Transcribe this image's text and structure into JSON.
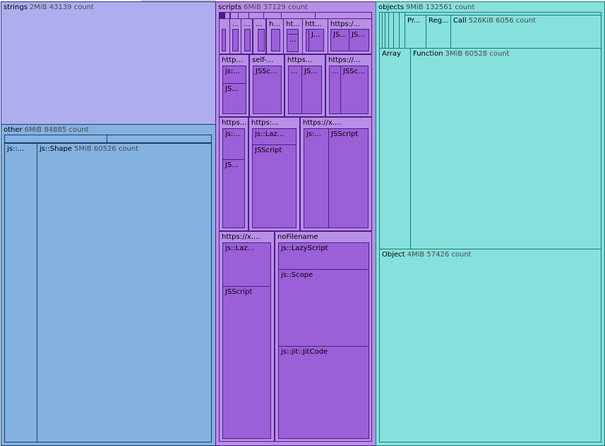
{
  "chart_data": {
    "type": "treemap",
    "colors": {
      "strings": {
        "fill": "#aeaeee",
        "border": "#2a2a8c"
      },
      "other": {
        "fill": "#84b2e0",
        "border": "#1b3d6e"
      },
      "scripts": {
        "fill": "#b98ee6",
        "border": "#4a1e8a"
      },
      "scripts_leaf": {
        "fill": "#9b5fd8",
        "border": "#4a1e8a"
      },
      "objects": {
        "fill": "#86e0de",
        "border": "#1a7a76"
      }
    },
    "groups": [
      {
        "name": "strings",
        "size": "2MiB",
        "count": "43139 count"
      },
      {
        "name": "other",
        "size": "6MiB",
        "count": "84885 count",
        "children": [
          {
            "name": "js::...",
            "size": "",
            "count": ""
          },
          {
            "name": "js::Shape",
            "size": "5MiB",
            "count": "60526 count"
          }
        ]
      },
      {
        "name": "scripts",
        "size": "6MiB",
        "count": "37129 count",
        "children": [
          {
            "name": "http..."
          },
          {
            "name": "self-..."
          },
          {
            "name": "https..."
          },
          {
            "name": "https://..."
          },
          {
            "name": "https..."
          },
          {
            "name": "https:..."
          },
          {
            "name": "https://x...."
          },
          {
            "name": "https://x...."
          },
          {
            "name": "noFilename",
            "children": [
              {
                "name": "js::LazyScript"
              },
              {
                "name": "js::Scope"
              },
              {
                "name": "js::jit::JitCode"
              }
            ]
          }
        ],
        "leaf_labels": [
          "...",
          "...",
          "...",
          "h...",
          "ht...",
          "htt...",
          "https:/...",
          "...",
          "J...",
          "JS...",
          "js:...",
          "JS...",
          "JSSc...",
          "...",
          "JS...",
          "JSSc...",
          "JS...",
          "js::Laz...",
          "JSScript",
          "JSScript",
          "js::Laz...",
          "JSScript"
        ]
      },
      {
        "name": "objects",
        "size": "9MiB",
        "count": "132561 count",
        "children": [
          {
            "name": "Pr..."
          },
          {
            "name": "Reg..."
          },
          {
            "name": "Call",
            "size": "526KiB",
            "count": "6056 count"
          },
          {
            "name": "Array"
          },
          {
            "name": "Function",
            "size": "3MiB",
            "count": "60528 count"
          },
          {
            "name": "Object",
            "size": "4MiB",
            "count": "57426 count"
          }
        ]
      }
    ]
  }
}
